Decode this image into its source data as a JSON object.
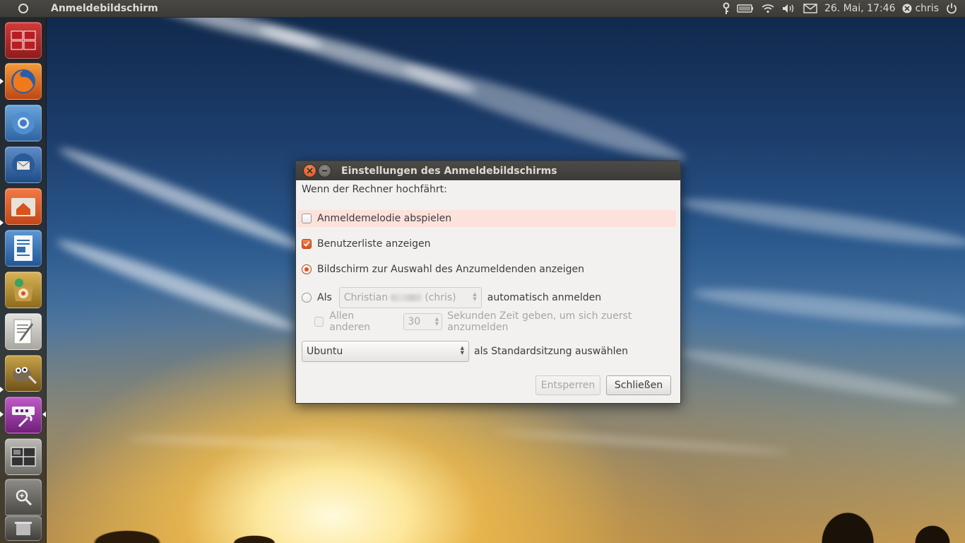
{
  "panel": {
    "app_title": "Anmeldebildschirm",
    "datetime": "26. Mai, 17:46",
    "user": "chris"
  },
  "launcher": {
    "items": [
      {
        "name": "workspace-switcher",
        "icon": "workspaces-icon",
        "color": "#c0262b"
      },
      {
        "name": "firefox",
        "icon": "firefox-icon",
        "color": "#e66a1f"
      },
      {
        "name": "chromium",
        "icon": "chromium-icon",
        "color": "#3d7fc4"
      },
      {
        "name": "thunderbird",
        "icon": "thunderbird-icon",
        "color": "#3a6aa8"
      },
      {
        "name": "home-folder",
        "icon": "home-folder-icon",
        "color": "#e2612b"
      },
      {
        "name": "libreoffice-writer",
        "icon": "writer-icon",
        "color": "#2f6fb0"
      },
      {
        "name": "software-center",
        "icon": "software-center-icon",
        "color": "#b7922c"
      },
      {
        "name": "text-editor",
        "icon": "text-editor-icon",
        "color": "#b8b5ae"
      },
      {
        "name": "gimp",
        "icon": "gimp-icon",
        "color": "#a98226"
      },
      {
        "name": "login-settings",
        "icon": "settings-tool-icon",
        "color": "#9d3aa8"
      },
      {
        "name": "workspaces",
        "icon": "workspace-grid-icon",
        "color": "#8f8d88"
      },
      {
        "name": "magnifier",
        "icon": "zoom-icon",
        "color": "#7b7975"
      },
      {
        "name": "trash",
        "icon": "trash-icon",
        "color": "#6a6864"
      }
    ]
  },
  "dialog": {
    "title": "Einstellungen des Anmeldebildschirms",
    "intro": "Wenn der Rechner hochfährt:",
    "play_sound": "Anmeldemelodie abspielen",
    "show_userlist": "Benutzerliste anzeigen",
    "show_chooser": "Bildschirm zur Auswahl des Anzumeldenden anzeigen",
    "as_label": "Als",
    "user_first": "Christian",
    "user_login": "(chris)",
    "auto_login": "automatisch anmelden",
    "others_label": "Allen anderen",
    "seconds_value": "30",
    "seconds_text": "Sekunden Zeit geben, um sich zuerst anzumelden",
    "session_value": "Ubuntu",
    "session_text": "als Standardsitzung auswählen",
    "unlock_button": "Entsperren",
    "close_button": "Schließen"
  }
}
